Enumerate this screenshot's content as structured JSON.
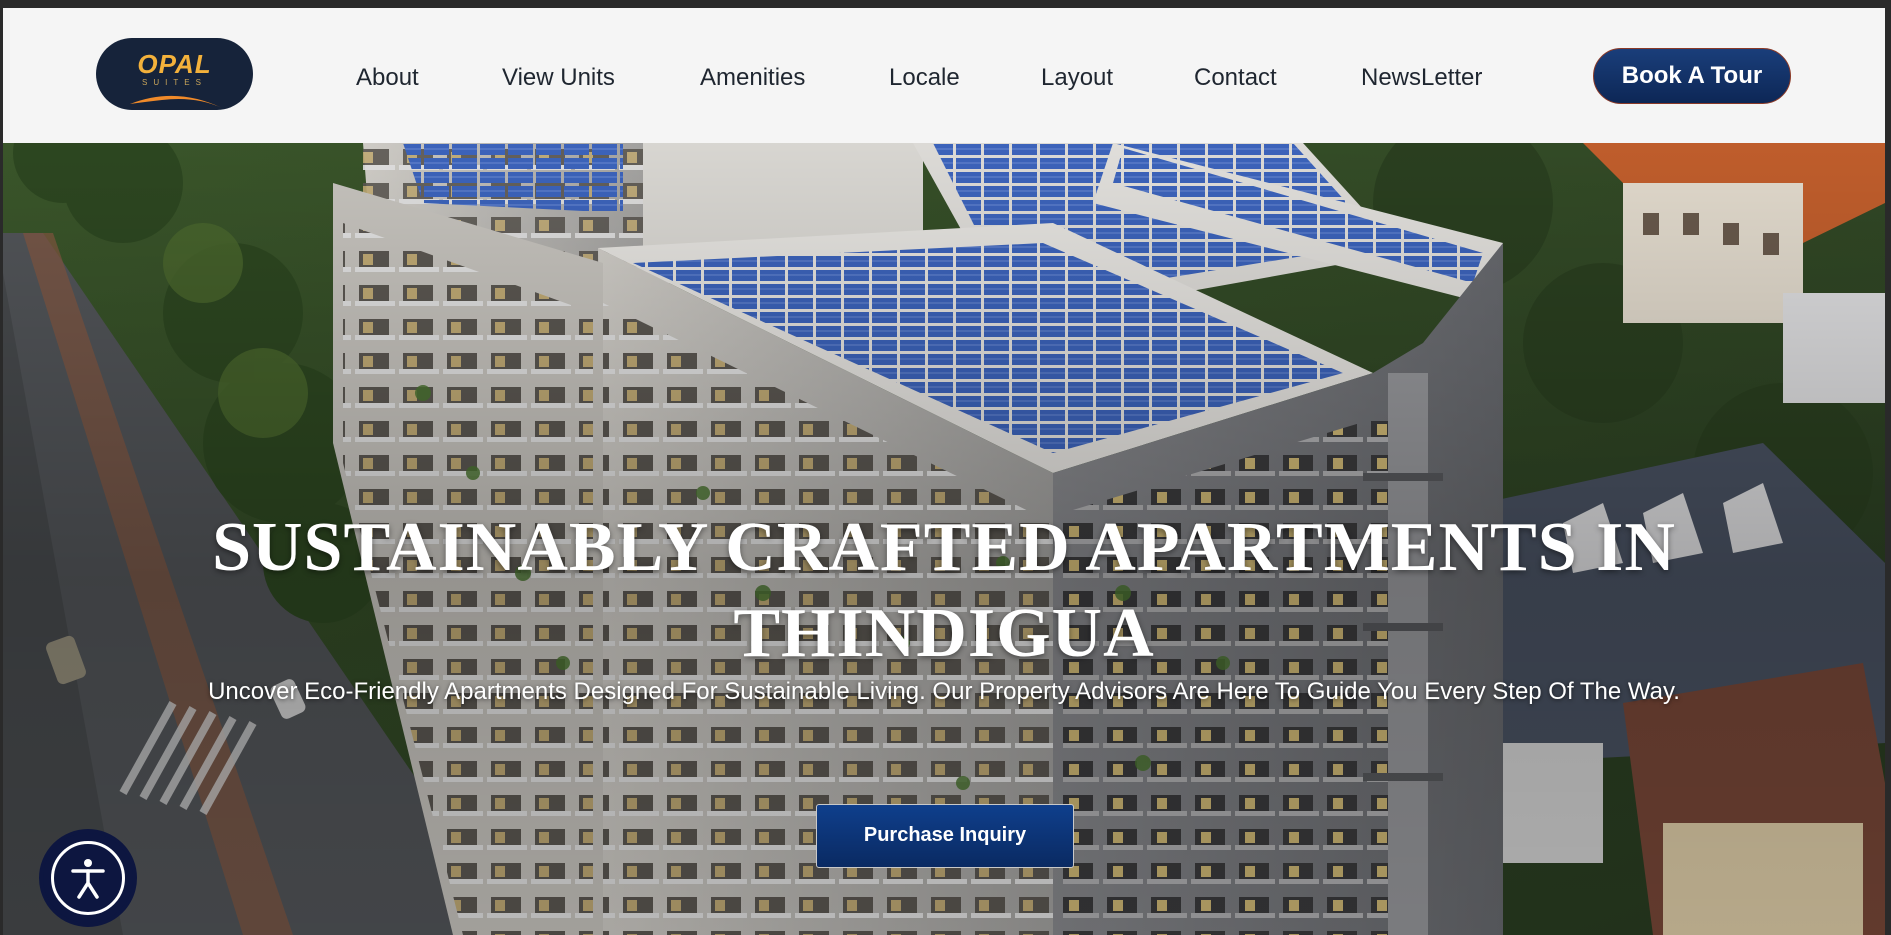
{
  "brand": {
    "name": "OPAL",
    "tagline": "SUITES",
    "colors": {
      "navy": "#16233a",
      "gold": "#f3b13b",
      "button_blue": "#0f3f8c"
    }
  },
  "nav": {
    "items": [
      {
        "label": "About"
      },
      {
        "label": "View Units"
      },
      {
        "label": "Amenities"
      },
      {
        "label": "Locale"
      },
      {
        "label": "Layout"
      },
      {
        "label": "Contact"
      },
      {
        "label": "NewsLetter"
      }
    ],
    "cta_label": "Book A Tour"
  },
  "hero": {
    "title_line1": "SUSTAINABLY CRAFTED APARTMENTS IN",
    "title_line2": "THINDIGUA",
    "subtitle": "Uncover Eco-Friendly Apartments Designed For Sustainable Living. Our Property Advisors Are Here To Guide You Every Step Of The Way.",
    "cta_label": "Purchase Inquiry"
  },
  "accessibility": {
    "icon": "accessibility-icon"
  }
}
